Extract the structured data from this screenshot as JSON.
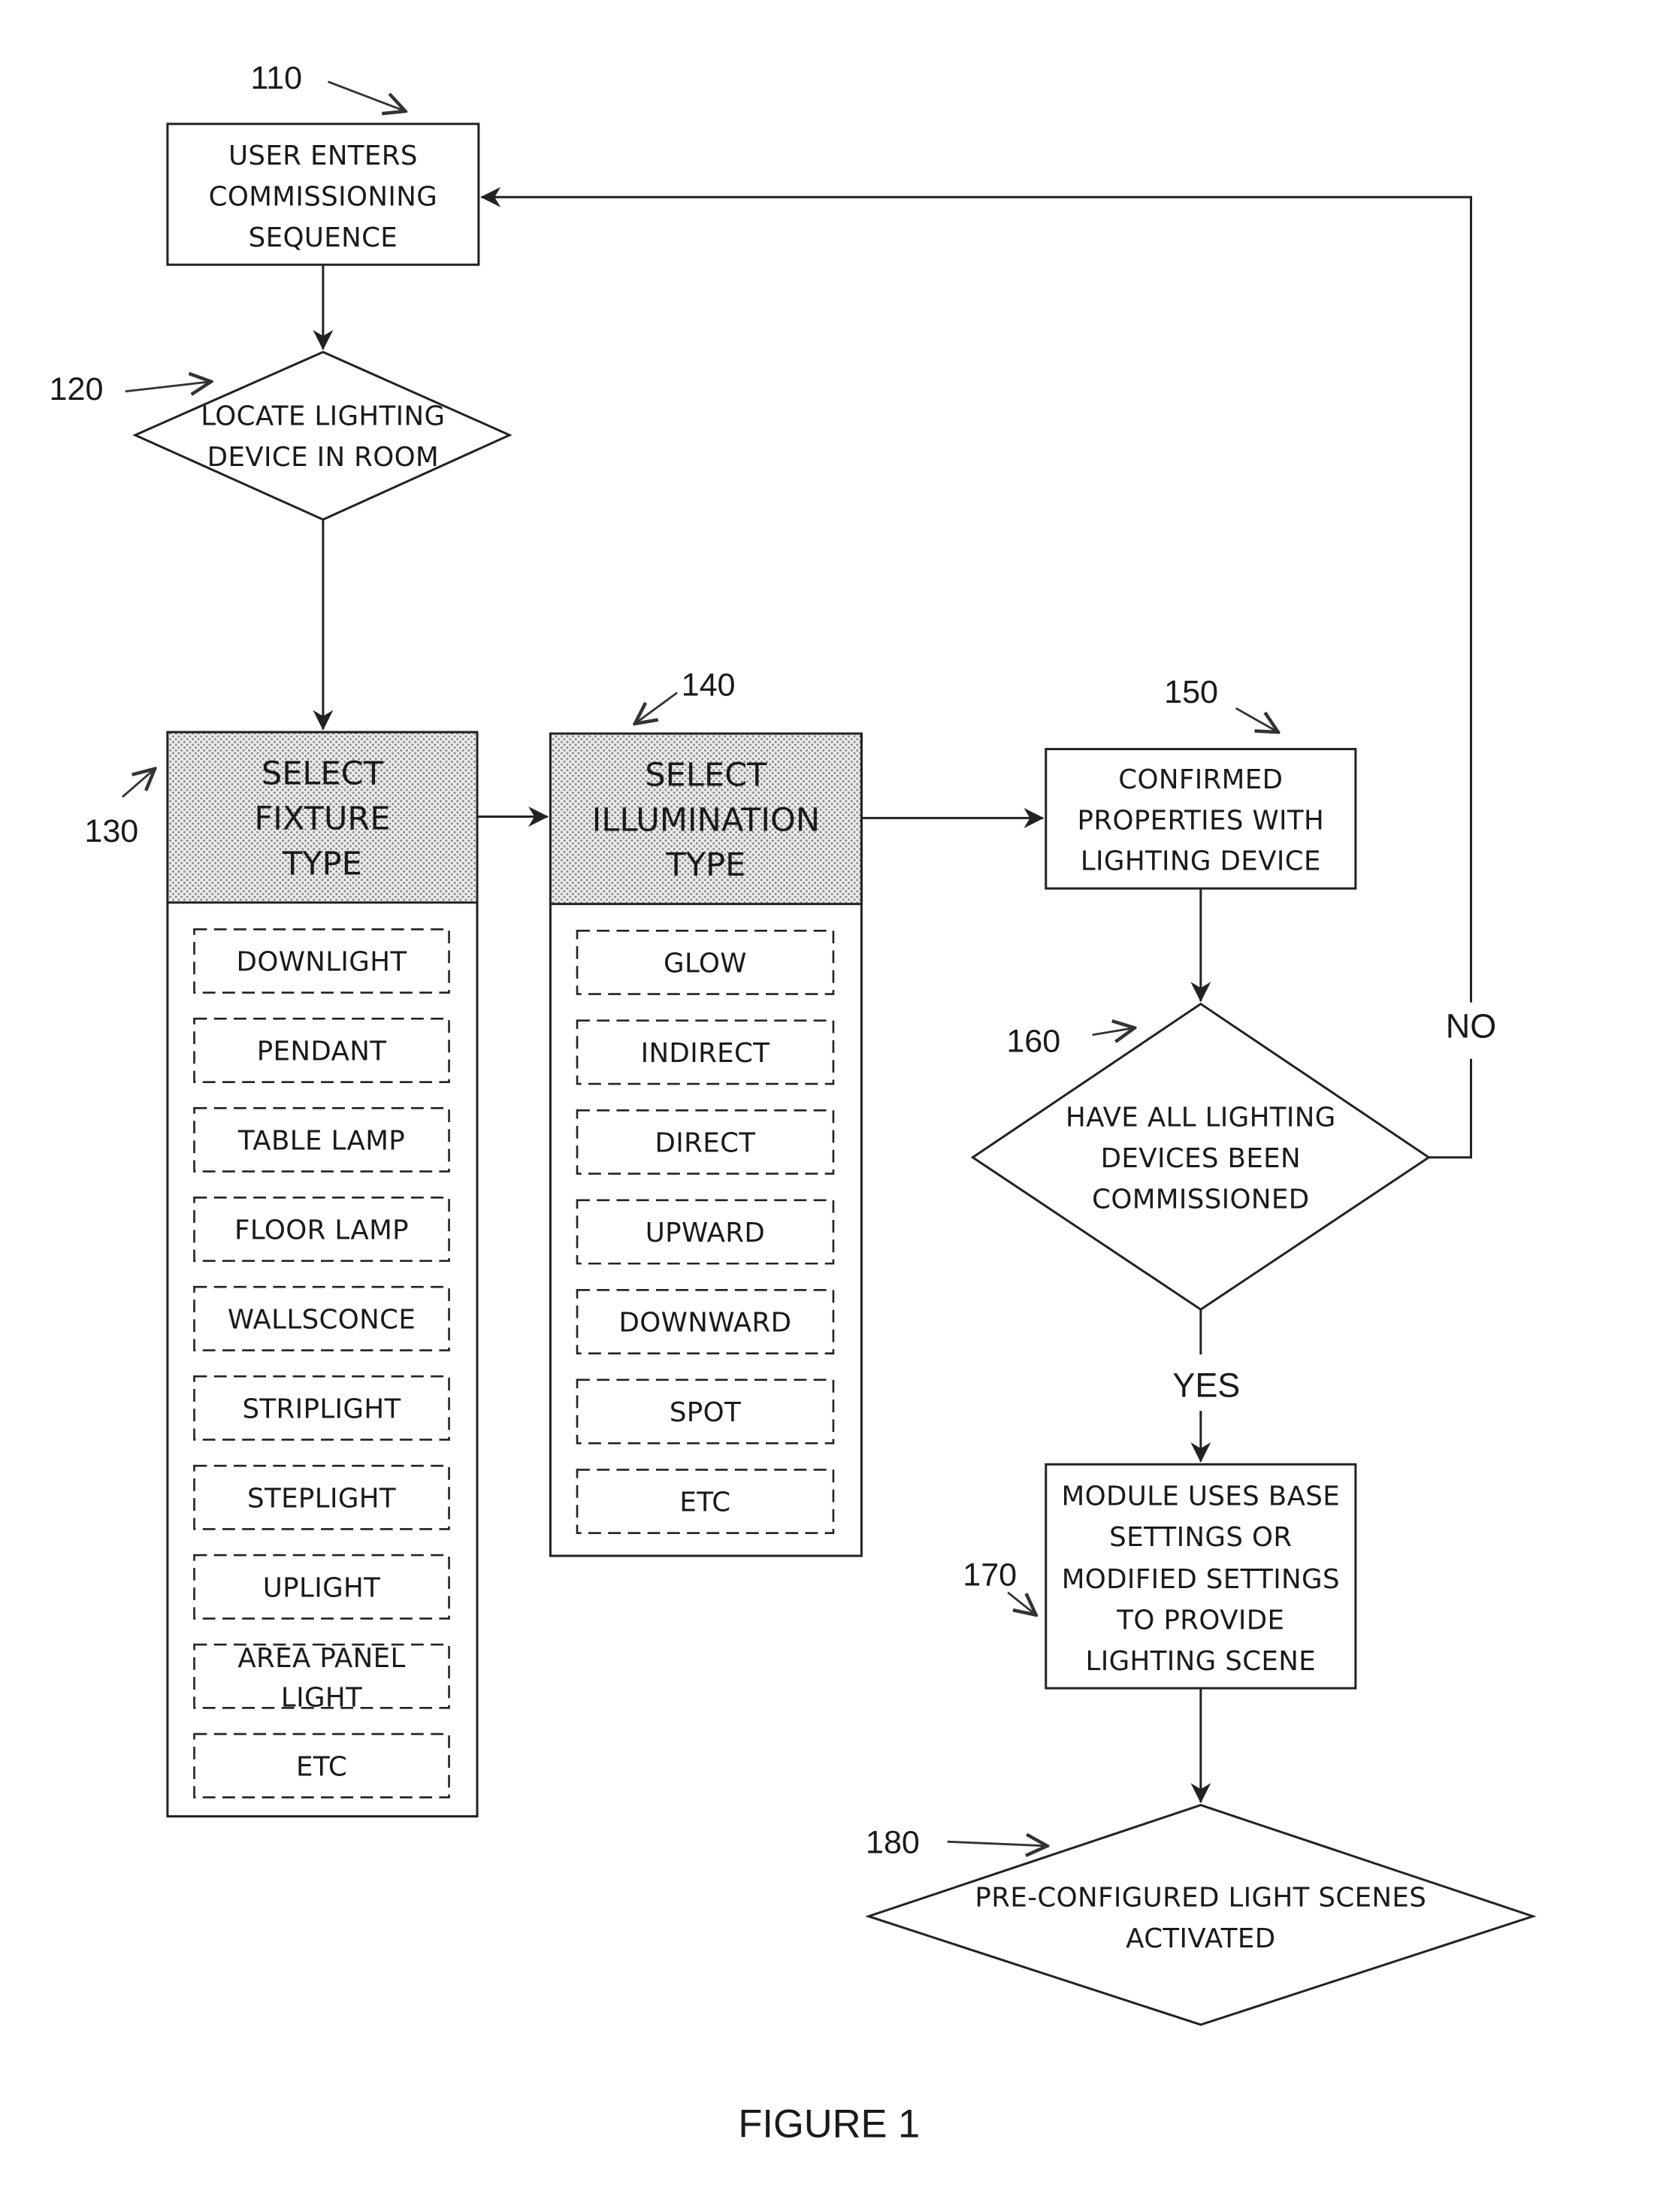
{
  "figure_caption": "FIGURE 1",
  "colors": {
    "line": "#222222",
    "header_fill": "#d9d9d9",
    "background": "#ffffff"
  },
  "steps": {
    "s110": {
      "ref": "110",
      "shape": "rectangle",
      "lines": [
        "USER ENTERS",
        "COMMISSIONING",
        "SEQUENCE"
      ]
    },
    "s120": {
      "ref": "120",
      "shape": "diamond",
      "lines": [
        "LOCATE LIGHTING",
        "DEVICE IN ROOM"
      ]
    },
    "s130": {
      "ref": "130",
      "shape": "list-panel",
      "header": [
        "SELECT",
        "FIXTURE",
        "TYPE"
      ],
      "options": [
        "DOWNLIGHT",
        "PENDANT",
        "TABLE LAMP",
        "FLOOR LAMP",
        "WALLSCONCE",
        "STRIPLIGHT",
        "STEPLIGHT",
        "UPLIGHT",
        "AREA PANEL LIGHT",
        "ETC"
      ]
    },
    "s140": {
      "ref": "140",
      "shape": "list-panel",
      "header": [
        "SELECT",
        "ILLUMINATION",
        "TYPE"
      ],
      "options": [
        "GLOW",
        "INDIRECT",
        "DIRECT",
        "UPWARD",
        "DOWNWARD",
        "SPOT",
        "ETC"
      ]
    },
    "s150": {
      "ref": "150",
      "shape": "rectangle",
      "lines": [
        "CONFIRMED",
        "PROPERTIES WITH",
        "LIGHTING DEVICE"
      ]
    },
    "s160": {
      "ref": "160",
      "shape": "diamond",
      "lines": [
        "HAVE ALL LIGHTING",
        "DEVICES BEEN",
        "COMMISSIONED"
      ]
    },
    "s170": {
      "ref": "170",
      "shape": "rectangle",
      "lines": [
        "MODULE USES BASE",
        "SETTINGS OR",
        "MODIFIED SETTINGS",
        "TO PROVIDE",
        "LIGHTING SCENE"
      ]
    },
    "s180": {
      "ref": "180",
      "shape": "diamond",
      "lines": [
        "PRE-CONFIGURED LIGHT SCENES",
        "ACTIVATED"
      ]
    }
  },
  "edge_labels": {
    "no": "NO",
    "yes": "YES"
  },
  "edges": [
    {
      "from": "110",
      "to": "120"
    },
    {
      "from": "120",
      "to": "130"
    },
    {
      "from": "130",
      "to": "140"
    },
    {
      "from": "140",
      "to": "150"
    },
    {
      "from": "150",
      "to": "160"
    },
    {
      "from": "160",
      "to": "110",
      "label": "NO"
    },
    {
      "from": "160",
      "to": "170",
      "label": "YES"
    },
    {
      "from": "170",
      "to": "180"
    }
  ]
}
